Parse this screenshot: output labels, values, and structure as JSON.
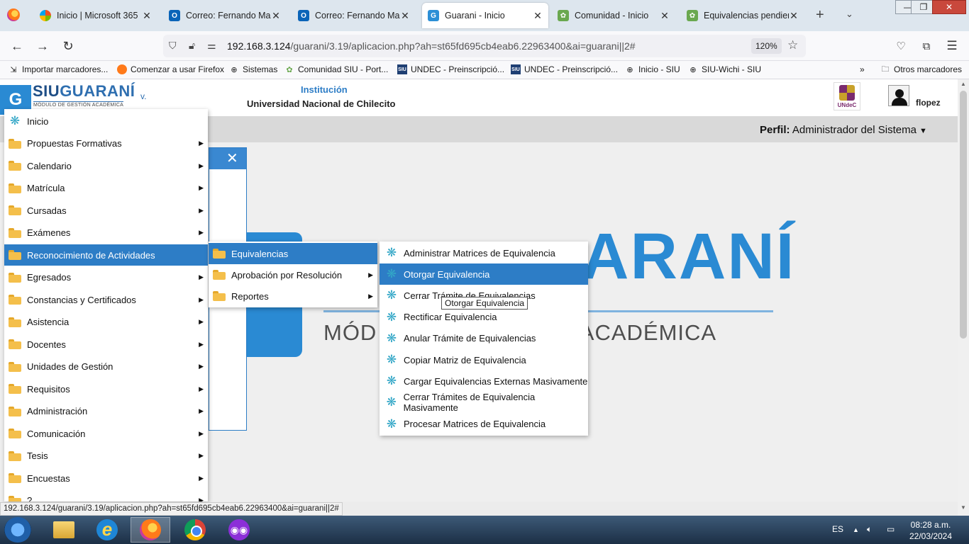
{
  "browser": {
    "tabs": [
      {
        "title": "Inicio | Microsoft 365",
        "icon": "microsoft365-icon"
      },
      {
        "title": "Correo: Fernando Marcelo",
        "icon": "outlook-icon"
      },
      {
        "title": "Correo: Fernando Marcelo",
        "icon": "outlook-icon"
      },
      {
        "title": "Guarani - Inicio",
        "icon": "guarani-icon",
        "active": true
      },
      {
        "title": "Comunidad - Inicio",
        "icon": "community-icon"
      },
      {
        "title": "Equivalencias pendientes",
        "icon": "community-icon"
      }
    ],
    "url_host": "192.168.3.124",
    "url_path": "/guarani/3.19/aplicacion.php?ah=st65fd695cb4eab6.22963400&ai=guarani||2#",
    "zoom": "120%",
    "bookmarks": [
      {
        "label": "Importar marcadores...",
        "icon": "import-icon"
      },
      {
        "label": "Comenzar a usar Firefox",
        "icon": "firefox-icon"
      },
      {
        "label": "Sistemas",
        "icon": "globe-icon"
      },
      {
        "label": "Comunidad SIU - Port...",
        "icon": "community-icon"
      },
      {
        "label": "UNDEC - Preinscripció...",
        "icon": "siu-icon"
      },
      {
        "label": "UNDEC - Preinscripció...",
        "icon": "siu-icon"
      },
      {
        "label": "Inicio - SIU",
        "icon": "globe-icon"
      },
      {
        "label": "SIU-Wichi - SIU",
        "icon": "globe-icon"
      }
    ],
    "other_bookmarks": "Otros marcadores",
    "status_url": "192.168.3.124/guarani/3.19/aplicacion.php?ah=st65fd695cb4eab6.22963400&ai=guarani||2#"
  },
  "app": {
    "logo": {
      "siu": "SIU",
      "guarani": "GUARANÍ",
      "subtitle": "MÓDULO DE GESTIÓN ACADÉMICA",
      "version": "v."
    },
    "institution_label": "Institución",
    "institution_name": "Universidad Nacional de Chilecito",
    "institution_logo_text": "UNdeC",
    "username": "flopez",
    "profile_label": "Perfil:",
    "profile_value": "Administrador del Sistema",
    "hero": {
      "title": "ARANÍ",
      "subtitle_left": "MÓD",
      "subtitle_right": "ACADÉMICA"
    }
  },
  "main_menu": [
    {
      "label": "Inicio",
      "icon": "snowflake-icon",
      "submenu": false
    },
    {
      "label": "Propuestas Formativas",
      "icon": "folder-icon",
      "submenu": true
    },
    {
      "label": "Calendario",
      "icon": "folder-icon",
      "submenu": true
    },
    {
      "label": "Matrícula",
      "icon": "folder-icon",
      "submenu": true
    },
    {
      "label": "Cursadas",
      "icon": "folder-icon",
      "submenu": true
    },
    {
      "label": "Exámenes",
      "icon": "folder-icon",
      "submenu": true
    },
    {
      "label": "Reconocimiento de Actividades",
      "icon": "folder-icon",
      "submenu": false,
      "selected": true
    },
    {
      "label": "Egresados",
      "icon": "folder-icon",
      "submenu": true
    },
    {
      "label": "Constancias y Certificados",
      "icon": "folder-icon",
      "submenu": true
    },
    {
      "label": "Asistencia",
      "icon": "folder-icon",
      "submenu": true
    },
    {
      "label": "Docentes",
      "icon": "folder-icon",
      "submenu": true
    },
    {
      "label": "Unidades de Gestión",
      "icon": "folder-icon",
      "submenu": true
    },
    {
      "label": "Requisitos",
      "icon": "folder-icon",
      "submenu": true
    },
    {
      "label": "Administración",
      "icon": "folder-icon",
      "submenu": true
    },
    {
      "label": "Comunicación",
      "icon": "folder-icon",
      "submenu": true
    },
    {
      "label": "Tesis",
      "icon": "folder-icon",
      "submenu": true
    },
    {
      "label": "Encuestas",
      "icon": "folder-icon",
      "submenu": true
    },
    {
      "label": "?",
      "icon": "folder-icon",
      "submenu": true
    }
  ],
  "sub_menu": [
    {
      "label": "Equivalencias",
      "selected": true
    },
    {
      "label": "Aprobación por Resolución",
      "submenu": true
    },
    {
      "label": "Reportes",
      "submenu": true
    }
  ],
  "equivalencias_menu": [
    {
      "label": "Administrar Matrices de Equivalencia"
    },
    {
      "label": "Otorgar Equivalencia",
      "selected": true
    },
    {
      "label": "Cerrar Trámite de Equivalencias"
    },
    {
      "label": "Rectificar Equivalencia"
    },
    {
      "label": "Anular Trámite de Equivalencias"
    },
    {
      "label": "Copiar Matriz de Equivalencia"
    },
    {
      "label": "Cargar Equivalencias Externas Masivamente"
    },
    {
      "label": "Cerrar Trámites de Equivalencia Masivamente"
    },
    {
      "label": "Procesar Matrices de Equivalencia"
    }
  ],
  "tooltip": "Otorgar Equivalencia",
  "taskbar": {
    "language": "ES",
    "time": "08:28 a.m.",
    "date": "22/03/2024"
  },
  "colors": {
    "accent": "#2d7dc6",
    "brand": "#2a8ad3",
    "folder": "#f4bf4b"
  }
}
